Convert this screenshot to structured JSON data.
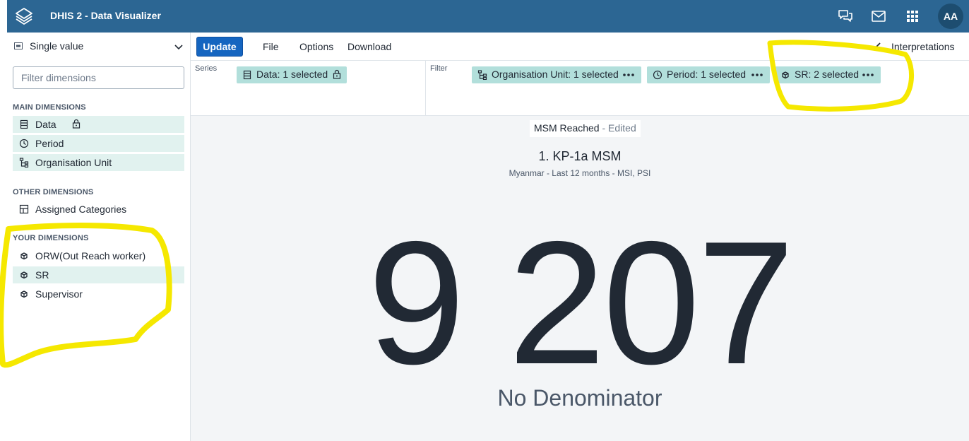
{
  "header": {
    "app_title": "DHIS 2 - Data Visualizer",
    "avatar_initials": "AA",
    "icons": [
      "dhis2-logo-icon",
      "interpretations-chat-icon",
      "mail-icon",
      "apps-grid-icon"
    ]
  },
  "left_panel": {
    "vis_type": "Single value",
    "filter_placeholder": "Filter dimensions",
    "main_dimensions_title": "MAIN DIMENSIONS",
    "main_dimensions": [
      {
        "label": "Data",
        "icon": "data-icon",
        "locked": true,
        "selected": true
      },
      {
        "label": "Period",
        "icon": "clock-icon",
        "selected": true
      },
      {
        "label": "Organisation Unit",
        "icon": "org-tree-icon",
        "selected": true
      }
    ],
    "other_dimensions_title": "OTHER DIMENSIONS",
    "other_dimensions": [
      {
        "label": "Assigned Categories",
        "icon": "table-icon"
      }
    ],
    "your_dimensions_title": "YOUR DIMENSIONS",
    "your_dimensions": [
      {
        "label": "ORW(Out Reach worker)",
        "icon": "cube-icon",
        "selected": false
      },
      {
        "label": "SR",
        "icon": "cube-icon",
        "selected": true
      },
      {
        "label": "Supervisor",
        "icon": "cube-icon",
        "selected": false
      }
    ]
  },
  "toolbar": {
    "update_label": "Update",
    "file_label": "File",
    "options_label": "Options",
    "download_label": "Download",
    "interpretations_label": "Interpretations"
  },
  "layout": {
    "series_label": "Series",
    "filter_label": "Filter",
    "series_chips": [
      {
        "label": "Data: 1 selected",
        "icon": "data-icon",
        "locked": true
      }
    ],
    "filter_chips": [
      {
        "label": "Organisation Unit: 1 selected",
        "icon": "org-tree-icon"
      },
      {
        "label": "Period: 1 selected",
        "icon": "clock-icon"
      },
      {
        "label": "SR: 2 selected",
        "icon": "cube-icon"
      }
    ]
  },
  "visualization": {
    "name": "MSM Reached",
    "edited_suffix": "- Edited",
    "title": "1. KP-1a MSM",
    "subtitle": "Myanmar - Last 12 months - MSI, PSI",
    "value": "9 207",
    "subtext": "No Denominator"
  },
  "colors": {
    "header_bg": "#2c6693",
    "chip_bg": "#b2dfdb",
    "selected_item_bg": "#e1f2ef",
    "update_button": "#1565c0",
    "annotation_yellow": "#f5e800"
  }
}
